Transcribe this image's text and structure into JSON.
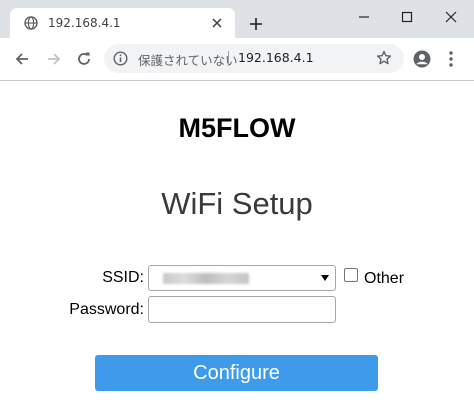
{
  "browser": {
    "tab": {
      "title": "192.168.4.1",
      "favicon": "globe-icon",
      "close": "close-icon"
    },
    "new_tab": "plus-icon",
    "window_controls": [
      "minimize-icon",
      "maximize-icon",
      "close-icon"
    ],
    "toolbar": {
      "back": "arrow-left-icon",
      "forward": "arrow-right-icon",
      "reload": "reload-icon",
      "security_text": "保護されていない",
      "url": "192.168.4.1",
      "bookmark": "star-icon",
      "profile": "profile-icon",
      "menu": "kebab-menu-icon"
    }
  },
  "page": {
    "title": "M5FLOW",
    "subtitle": "WiFi Setup",
    "form": {
      "ssid_label": "SSID:",
      "ssid_value": "",
      "other_label": "Other",
      "other_checked": false,
      "password_label": "Password:",
      "password_value": "",
      "submit_label": "Configure"
    }
  },
  "colors": {
    "tabstrip_bg": "#dee1e6",
    "omnibox_bg": "#f1f3f4",
    "button_bg": "#3d9be9",
    "button_text": "#ffffff"
  }
}
